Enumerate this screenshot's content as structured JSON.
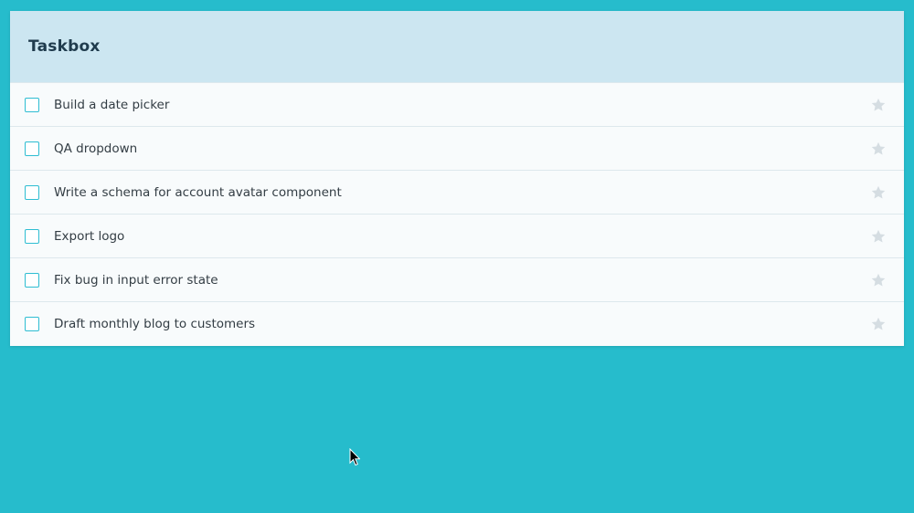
{
  "app": {
    "title": "Taskbox"
  },
  "colors": {
    "background": "#26bccc",
    "header": "#cce6f1",
    "checkbox_border": "#2ebdd2",
    "star": "#d5dde2"
  },
  "tasks": [
    {
      "title": "Build a date picker",
      "checked": false,
      "starred": false
    },
    {
      "title": "QA dropdown",
      "checked": false,
      "starred": false
    },
    {
      "title": "Write a schema for account avatar component",
      "checked": false,
      "starred": false
    },
    {
      "title": "Export logo",
      "checked": false,
      "starred": false
    },
    {
      "title": "Fix bug in input error state",
      "checked": false,
      "starred": false
    },
    {
      "title": "Draft monthly blog to customers",
      "checked": false,
      "starred": false
    }
  ],
  "icons": {
    "checkbox": "checkbox-icon",
    "star": "star-icon",
    "cursor": "mouse-pointer-icon"
  }
}
